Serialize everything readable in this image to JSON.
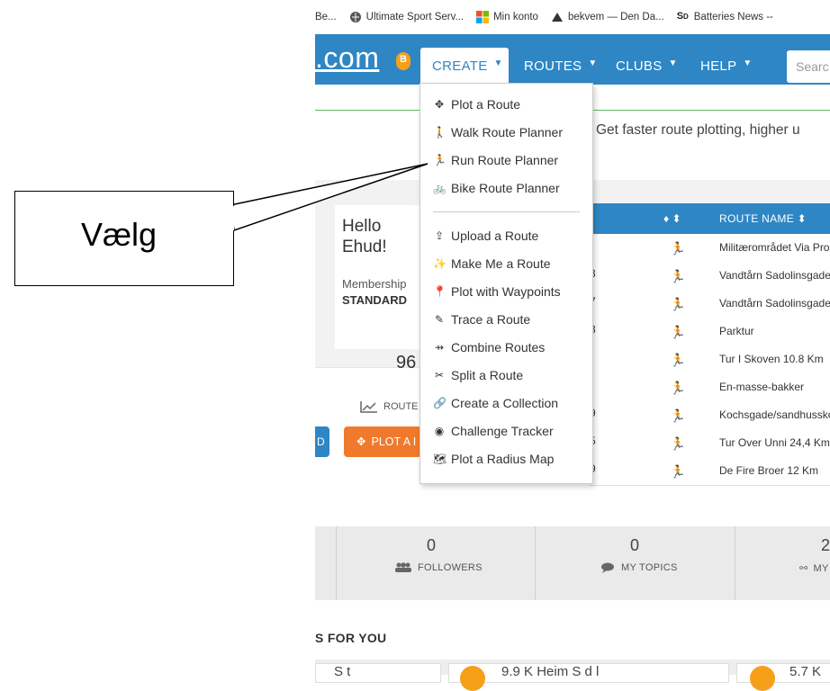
{
  "bookmarks": [
    {
      "label": "Be...",
      "icon": "bookmark-icon"
    },
    {
      "label": "Ultimate Sport Serv...",
      "icon": "globe-icon"
    },
    {
      "label": "Min konto",
      "icon": "windows-icon"
    },
    {
      "label": "bekvem — Den Da...",
      "icon": "site-icon"
    },
    {
      "label": "Batteries News --",
      "icon": "sd-icon"
    }
  ],
  "nav": {
    "logo": ".com",
    "logo_badge": "B",
    "items": [
      {
        "label": "CREATE",
        "caret": "▼"
      },
      {
        "label": "ROUTES",
        "caret": "▼"
      },
      {
        "label": "CLUBS",
        "caret": "▼"
      },
      {
        "label": "HELP",
        "caret": "▼"
      }
    ],
    "search_placeholder": "Searc"
  },
  "promo_text": "Get faster route plotting, higher u",
  "profile": {
    "greeting_line1": "Hello",
    "greeting_line2": "Ehud!",
    "membership_label": "Membership",
    "membership_value": "STANDARD",
    "routes_count": "96",
    "routes_label": "ROUTE"
  },
  "table": {
    "header_pin": "♦ ⬍",
    "header_name": "ROUTE NAME ⬍",
    "rows": [
      {
        "edge": ")",
        "activity": "🏃",
        "name": "Militærområdet Via Pro"
      },
      {
        "edge": "3",
        "activity": "🏃",
        "name": "Vandtårn Sadolinsgade"
      },
      {
        "edge": "7",
        "activity": "🏃",
        "name": "Vandtårn Sadolinsgade"
      },
      {
        "edge": "3",
        "activity": "🏃",
        "name": "Parktur"
      },
      {
        "edge": ")",
        "activity": "🏃",
        "name": "Tur I Skoven 10.8 Km"
      },
      {
        "edge": ")",
        "activity": "🏃",
        "name": "En-masse-bakker"
      },
      {
        "edge": "9",
        "activity": "🏃",
        "name": "Kochsgade/sandhusskov"
      },
      {
        "edge": "5",
        "activity": "🏃",
        "name": "Tur Over Unni 24,4 Km"
      },
      {
        "edge": "9",
        "activity": "🏃",
        "name": "De Fire Broer 12 Km"
      }
    ]
  },
  "buttons": {
    "blue_label": "D",
    "orange_label": "PLOT A I"
  },
  "create_menu": [
    {
      "label": "Plot a Route",
      "icon": "✥"
    },
    {
      "label": "Walk Route Planner",
      "icon": "🚶"
    },
    {
      "label": "Run Route Planner",
      "icon": "🏃"
    },
    {
      "label": "Bike Route Planner",
      "icon": "🚲"
    },
    {
      "label": "Upload a Route",
      "icon": "⇪"
    },
    {
      "label": "Make Me a Route",
      "icon": "✨"
    },
    {
      "label": "Plot with Waypoints",
      "icon": "📍"
    },
    {
      "label": "Trace a Route",
      "icon": "✎"
    },
    {
      "label": "Combine Routes",
      "icon": "⇸"
    },
    {
      "label": "Split a Route",
      "icon": "✂"
    },
    {
      "label": "Create a Collection",
      "icon": "🔗"
    },
    {
      "label": "Challenge Tracker",
      "icon": "◉"
    },
    {
      "label": "Plot a Radius Map",
      "icon": "🗺"
    }
  ],
  "lower_stats": [
    {
      "num": "0",
      "label": "FOLLOWERS",
      "icon": "users-icon"
    },
    {
      "num": "0",
      "label": "MY TOPICS",
      "icon": "chat-icon"
    },
    {
      "num": "2",
      "label": "MY",
      "icon": "handshake-icon"
    }
  ],
  "for_you": "S FOR YOU",
  "bottom_cards": [
    {
      "text": "S t"
    },
    {
      "text": "9.9 K  Heim  S    d  l"
    },
    {
      "text": "5.7 K"
    }
  ],
  "callout": {
    "text": "Vælg"
  }
}
